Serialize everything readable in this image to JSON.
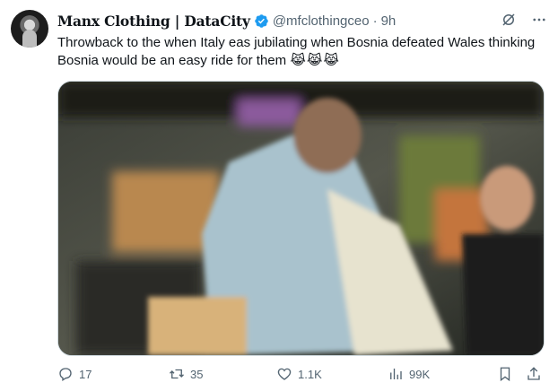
{
  "author": {
    "name": "Manx Clothing | DataCity",
    "handle": "@mfclothingceo",
    "separator": "·",
    "time": "9h",
    "verified": true
  },
  "tweet": {
    "text": "Throwback to the when Italy eas jubilating when Bosnia defeated Wales thinking Bosnia would be an easy ride for them",
    "emojis": "😹😹😹"
  },
  "media": {
    "type": "video-thumbnail"
  },
  "actions": {
    "replies": "17",
    "reposts": "35",
    "likes": "1.1K",
    "views": "99K"
  },
  "icons": {
    "verified": "verified-badge-icon",
    "grok": "grok-icon",
    "more": "more-icon",
    "reply": "reply-icon",
    "repost": "repost-icon",
    "like": "heart-icon",
    "views": "views-icon",
    "bookmark": "bookmark-icon",
    "share": "share-icon"
  },
  "colors": {
    "accent": "#1d9bf0",
    "muted": "#536471",
    "text": "#0f1419"
  }
}
